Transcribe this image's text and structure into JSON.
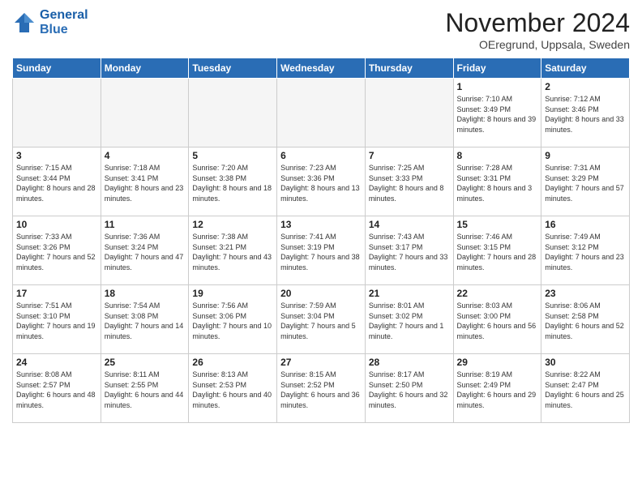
{
  "header": {
    "logo_line1": "General",
    "logo_line2": "Blue",
    "month_year": "November 2024",
    "location": "OEregrund, Uppsala, Sweden"
  },
  "weekdays": [
    "Sunday",
    "Monday",
    "Tuesday",
    "Wednesday",
    "Thursday",
    "Friday",
    "Saturday"
  ],
  "weeks": [
    [
      {
        "day": "",
        "empty": true
      },
      {
        "day": "",
        "empty": true
      },
      {
        "day": "",
        "empty": true
      },
      {
        "day": "",
        "empty": true
      },
      {
        "day": "",
        "empty": true
      },
      {
        "day": "1",
        "sunrise": "Sunrise: 7:10 AM",
        "sunset": "Sunset: 3:49 PM",
        "daylight": "Daylight: 8 hours and 39 minutes."
      },
      {
        "day": "2",
        "sunrise": "Sunrise: 7:12 AM",
        "sunset": "Sunset: 3:46 PM",
        "daylight": "Daylight: 8 hours and 33 minutes."
      }
    ],
    [
      {
        "day": "3",
        "sunrise": "Sunrise: 7:15 AM",
        "sunset": "Sunset: 3:44 PM",
        "daylight": "Daylight: 8 hours and 28 minutes."
      },
      {
        "day": "4",
        "sunrise": "Sunrise: 7:18 AM",
        "sunset": "Sunset: 3:41 PM",
        "daylight": "Daylight: 8 hours and 23 minutes."
      },
      {
        "day": "5",
        "sunrise": "Sunrise: 7:20 AM",
        "sunset": "Sunset: 3:38 PM",
        "daylight": "Daylight: 8 hours and 18 minutes."
      },
      {
        "day": "6",
        "sunrise": "Sunrise: 7:23 AM",
        "sunset": "Sunset: 3:36 PM",
        "daylight": "Daylight: 8 hours and 13 minutes."
      },
      {
        "day": "7",
        "sunrise": "Sunrise: 7:25 AM",
        "sunset": "Sunset: 3:33 PM",
        "daylight": "Daylight: 8 hours and 8 minutes."
      },
      {
        "day": "8",
        "sunrise": "Sunrise: 7:28 AM",
        "sunset": "Sunset: 3:31 PM",
        "daylight": "Daylight: 8 hours and 3 minutes."
      },
      {
        "day": "9",
        "sunrise": "Sunrise: 7:31 AM",
        "sunset": "Sunset: 3:29 PM",
        "daylight": "Daylight: 7 hours and 57 minutes."
      }
    ],
    [
      {
        "day": "10",
        "sunrise": "Sunrise: 7:33 AM",
        "sunset": "Sunset: 3:26 PM",
        "daylight": "Daylight: 7 hours and 52 minutes."
      },
      {
        "day": "11",
        "sunrise": "Sunrise: 7:36 AM",
        "sunset": "Sunset: 3:24 PM",
        "daylight": "Daylight: 7 hours and 47 minutes."
      },
      {
        "day": "12",
        "sunrise": "Sunrise: 7:38 AM",
        "sunset": "Sunset: 3:21 PM",
        "daylight": "Daylight: 7 hours and 43 minutes."
      },
      {
        "day": "13",
        "sunrise": "Sunrise: 7:41 AM",
        "sunset": "Sunset: 3:19 PM",
        "daylight": "Daylight: 7 hours and 38 minutes."
      },
      {
        "day": "14",
        "sunrise": "Sunrise: 7:43 AM",
        "sunset": "Sunset: 3:17 PM",
        "daylight": "Daylight: 7 hours and 33 minutes."
      },
      {
        "day": "15",
        "sunrise": "Sunrise: 7:46 AM",
        "sunset": "Sunset: 3:15 PM",
        "daylight": "Daylight: 7 hours and 28 minutes."
      },
      {
        "day": "16",
        "sunrise": "Sunrise: 7:49 AM",
        "sunset": "Sunset: 3:12 PM",
        "daylight": "Daylight: 7 hours and 23 minutes."
      }
    ],
    [
      {
        "day": "17",
        "sunrise": "Sunrise: 7:51 AM",
        "sunset": "Sunset: 3:10 PM",
        "daylight": "Daylight: 7 hours and 19 minutes."
      },
      {
        "day": "18",
        "sunrise": "Sunrise: 7:54 AM",
        "sunset": "Sunset: 3:08 PM",
        "daylight": "Daylight: 7 hours and 14 minutes."
      },
      {
        "day": "19",
        "sunrise": "Sunrise: 7:56 AM",
        "sunset": "Sunset: 3:06 PM",
        "daylight": "Daylight: 7 hours and 10 minutes."
      },
      {
        "day": "20",
        "sunrise": "Sunrise: 7:59 AM",
        "sunset": "Sunset: 3:04 PM",
        "daylight": "Daylight: 7 hours and 5 minutes."
      },
      {
        "day": "21",
        "sunrise": "Sunrise: 8:01 AM",
        "sunset": "Sunset: 3:02 PM",
        "daylight": "Daylight: 7 hours and 1 minute."
      },
      {
        "day": "22",
        "sunrise": "Sunrise: 8:03 AM",
        "sunset": "Sunset: 3:00 PM",
        "daylight": "Daylight: 6 hours and 56 minutes."
      },
      {
        "day": "23",
        "sunrise": "Sunrise: 8:06 AM",
        "sunset": "Sunset: 2:58 PM",
        "daylight": "Daylight: 6 hours and 52 minutes."
      }
    ],
    [
      {
        "day": "24",
        "sunrise": "Sunrise: 8:08 AM",
        "sunset": "Sunset: 2:57 PM",
        "daylight": "Daylight: 6 hours and 48 minutes."
      },
      {
        "day": "25",
        "sunrise": "Sunrise: 8:11 AM",
        "sunset": "Sunset: 2:55 PM",
        "daylight": "Daylight: 6 hours and 44 minutes."
      },
      {
        "day": "26",
        "sunrise": "Sunrise: 8:13 AM",
        "sunset": "Sunset: 2:53 PM",
        "daylight": "Daylight: 6 hours and 40 minutes."
      },
      {
        "day": "27",
        "sunrise": "Sunrise: 8:15 AM",
        "sunset": "Sunset: 2:52 PM",
        "daylight": "Daylight: 6 hours and 36 minutes."
      },
      {
        "day": "28",
        "sunrise": "Sunrise: 8:17 AM",
        "sunset": "Sunset: 2:50 PM",
        "daylight": "Daylight: 6 hours and 32 minutes."
      },
      {
        "day": "29",
        "sunrise": "Sunrise: 8:19 AM",
        "sunset": "Sunset: 2:49 PM",
        "daylight": "Daylight: 6 hours and 29 minutes."
      },
      {
        "day": "30",
        "sunrise": "Sunrise: 8:22 AM",
        "sunset": "Sunset: 2:47 PM",
        "daylight": "Daylight: 6 hours and 25 minutes."
      }
    ]
  ]
}
